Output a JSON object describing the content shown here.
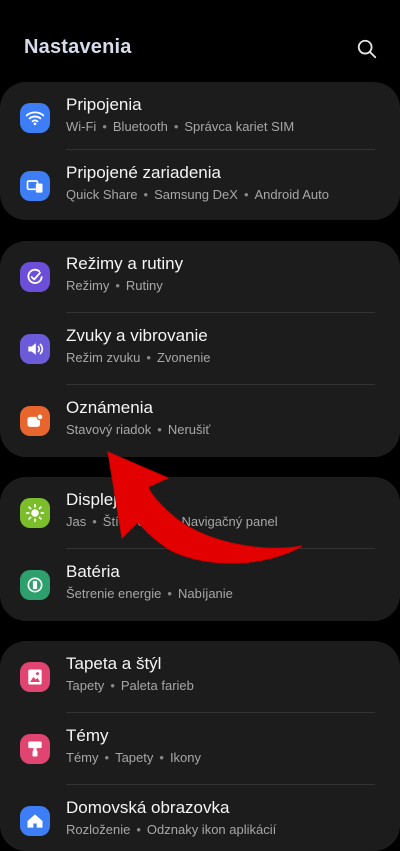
{
  "header": {
    "title": "Nastavenia"
  },
  "icons": {
    "search": "search-icon"
  },
  "groups": [
    {
      "items": [
        {
          "label": "Pripojenia",
          "sub": [
            "Wi-Fi",
            "Bluetooth",
            "Správca kariet SIM"
          ],
          "icon": "wifi-icon",
          "color": "#3d7df5"
        },
        {
          "label": "Pripojené zariadenia",
          "sub": [
            "Quick Share",
            "Samsung DeX",
            "Android Auto"
          ],
          "icon": "devices-icon",
          "color": "#3d7df5"
        }
      ]
    },
    {
      "items": [
        {
          "label": "Režimy a rutiny",
          "sub": [
            "Režimy",
            "Rutiny"
          ],
          "icon": "modes-icon",
          "color": "#6b4fd8"
        },
        {
          "label": "Zvuky a vibrovanie",
          "sub": [
            "Režim zvuku",
            "Zvonenie"
          ],
          "icon": "volume-icon",
          "color": "#6b5bd9"
        },
        {
          "label": "Oznámenia",
          "sub": [
            "Stavový riadok",
            "Nerušiť"
          ],
          "icon": "notifications-icon",
          "color": "#e8652e"
        }
      ]
    },
    {
      "items": [
        {
          "label": "Displej",
          "sub": [
            "Jas",
            "Štít pre oči",
            "Navigačný panel"
          ],
          "icon": "display-icon",
          "color": "#7bbd2b"
        },
        {
          "label": "Batéria",
          "sub": [
            "Šetrenie energie",
            "Nabíjanie"
          ],
          "icon": "battery-icon",
          "color": "#2ea06d"
        }
      ]
    },
    {
      "items": [
        {
          "label": "Tapeta a štýl",
          "sub": [
            "Tapety",
            "Paleta farieb"
          ],
          "icon": "wallpaper-icon",
          "color": "#e04470"
        },
        {
          "label": "Témy",
          "sub": [
            "Témy",
            "Tapety",
            "Ikony"
          ],
          "icon": "themes-icon",
          "color": "#e04470"
        },
        {
          "label": "Domovská obrazovka",
          "sub": [
            "Rozloženie",
            "Odznaky ikon aplikácií"
          ],
          "icon": "home-icon",
          "color": "#3d7df5"
        }
      ]
    }
  ],
  "annotation": {
    "color": "#e30000"
  }
}
